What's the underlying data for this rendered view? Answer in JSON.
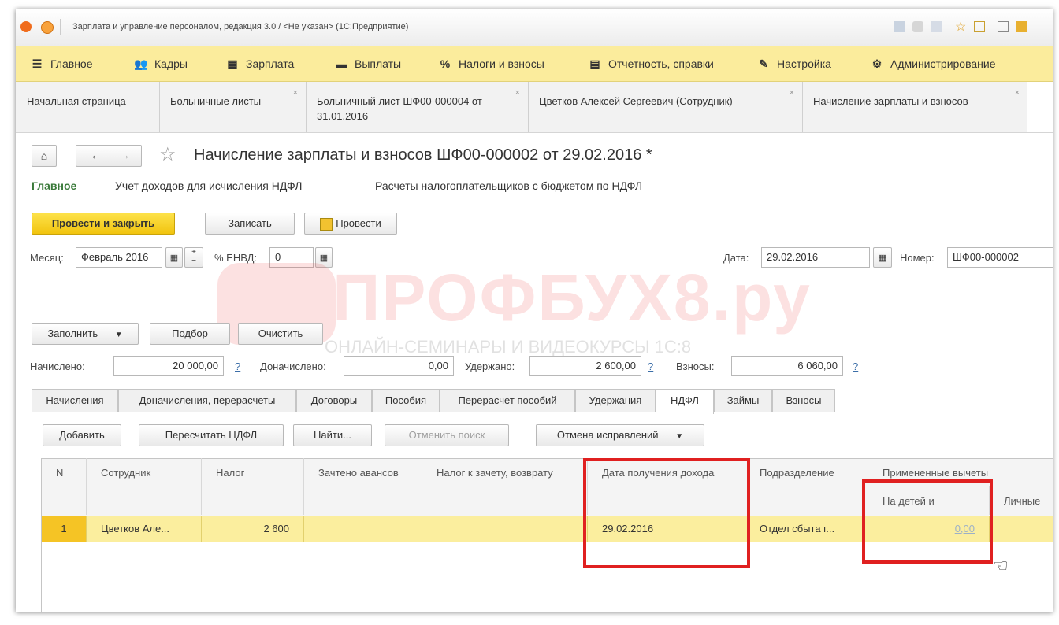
{
  "window": {
    "title": "Зарплата и управление персоналом, редакция 3.0 / <Не указан>  (1С:Предприятие)"
  },
  "menu": [
    {
      "label": "Главное",
      "icon": "menu-icon"
    },
    {
      "label": "Кадры",
      "icon": "people-icon"
    },
    {
      "label": "Зарплата",
      "icon": "calculator-icon"
    },
    {
      "label": "Выплаты",
      "icon": "money-icon"
    },
    {
      "label": "Налоги и взносы",
      "icon": "percent-icon"
    },
    {
      "label": "Отчетность, справки",
      "icon": "report-icon"
    },
    {
      "label": "Настройка",
      "icon": "wrench-icon"
    },
    {
      "label": "Администрирование",
      "icon": "gear-icon"
    }
  ],
  "open_tabs": [
    {
      "label": "Начальная страница"
    },
    {
      "label": "Больничные листы"
    },
    {
      "label": "Больничный лист ШФ00-000004 от 31.01.2016"
    },
    {
      "label": "Цветков Алексей Сергеевич (Сотрудник)"
    },
    {
      "label": "Начисление зарплаты и взносов"
    }
  ],
  "document": {
    "title": "Начисление зарплаты и взносов ШФ00-000002 от 29.02.2016 *",
    "nav_links": [
      "Главное",
      "Учет доходов для исчисления НДФЛ",
      "Расчеты налогоплательщиков с бюджетом по НДФЛ"
    ]
  },
  "toolbar": {
    "post_close": "Провести и закрыть",
    "save": "Записать",
    "post": "Провести"
  },
  "header_fields": {
    "month_label": "Месяц:",
    "month_value": "Февраль 2016",
    "envd_label": "% ЕНВД:",
    "envd_value": "0",
    "date_label": "Дата:",
    "date_value": "29.02.2016",
    "number_label": "Номер:",
    "number_value": "ШФ00-000002"
  },
  "actions": {
    "fill": "Заполнить",
    "pick": "Подбор",
    "clear": "Очистить"
  },
  "totals": {
    "accrued_label": "Начислено:",
    "accrued_value": "20 000,00",
    "additional_label": "Доначислено:",
    "additional_value": "0,00",
    "withheld_label": "Удержано:",
    "withheld_value": "2 600,00",
    "contrib_label": "Взносы:",
    "contrib_value": "6 060,00",
    "help": "?"
  },
  "form_tabs": [
    "Начисления",
    "Доначисления, перерасчеты",
    "Договоры",
    "Пособия",
    "Перерасчет пособий",
    "Удержания",
    "НДФЛ",
    "Займы",
    "Взносы"
  ],
  "active_tab": "НДФЛ",
  "table_toolbar": {
    "add": "Добавить",
    "recalc": "Пересчитать НДФЛ",
    "find": "Найти...",
    "cancel_search": "Отменить поиск",
    "cancel_fix": "Отмена исправлений"
  },
  "table": {
    "columns": {
      "n": "N",
      "employee": "Сотрудник",
      "tax": "Налог",
      "credited": "Зачтено авансов",
      "tax_refund": "Налог к зачету, возврату",
      "income_date": "Дата получения дохода",
      "department": "Подразделение",
      "deductions": "Примененные вычеты",
      "children": "На детей и",
      "personal": "Личные"
    },
    "rows": [
      {
        "n": "1",
        "employee": "Цветков Але...",
        "tax": "2 600",
        "credited": "",
        "tax_refund": "",
        "income_date": "29.02.2016",
        "department": "Отдел сбыта г...",
        "children": "0,00"
      }
    ]
  },
  "watermark": {
    "brand": "ПРОФБУХ8.ру",
    "tagline": "ОНЛАЙН-СЕМИНАРЫ И ВИДЕОКУРСЫ 1С:8"
  },
  "colors": {
    "menubar": "#fbec9c",
    "primary": "#f1c40f",
    "row_highlight": "#fbee9e",
    "nav_active": "#3a7a3a",
    "annotation": "#e02020"
  }
}
